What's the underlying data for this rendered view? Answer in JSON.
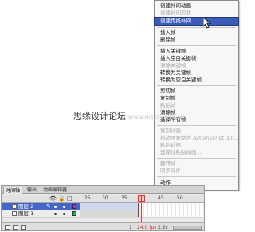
{
  "context_menu": {
    "items": [
      {
        "label": "创建补间动画",
        "enabled": true
      },
      {
        "label": "创建补间形状",
        "enabled": false
      },
      {
        "label": "创建传统补间",
        "enabled": true,
        "highlighted": true
      },
      {
        "label": "插入帧",
        "enabled": true
      },
      {
        "label": "删除帧",
        "enabled": true
      },
      {
        "label": "插入关键帧",
        "enabled": true
      },
      {
        "label": "插入空白关键帧",
        "enabled": true
      },
      {
        "label": "清除关键帧",
        "enabled": false
      },
      {
        "label": "转换为关键帧",
        "enabled": true
      },
      {
        "label": "转换为空白关键帧",
        "enabled": true
      },
      {
        "label": "剪切帧",
        "enabled": true
      },
      {
        "label": "复制帧",
        "enabled": true
      },
      {
        "label": "粘贴帧",
        "enabled": false
      },
      {
        "label": "清除帧",
        "enabled": true
      },
      {
        "label": "选择所有帧",
        "enabled": true
      },
      {
        "label": "复制动画",
        "enabled": false
      },
      {
        "label": "将动画复制为 ActionScript 3.0...",
        "enabled": false
      },
      {
        "label": "粘贴动画",
        "enabled": false
      },
      {
        "label": "选择性粘贴动画...",
        "enabled": false
      },
      {
        "label": "翻转帧",
        "enabled": false
      },
      {
        "label": "同步元件",
        "enabled": false
      },
      {
        "label": "动作",
        "enabled": true
      }
    ]
  },
  "watermark": {
    "text": "思缘设计论坛",
    "site": "WWW.MISSYUAN.COM"
  },
  "timeline": {
    "tabs": [
      "时间轴",
      "输出",
      "动画编辑器"
    ],
    "ruler_ticks": [
      "25",
      "30",
      "35",
      "40",
      "45",
      "50"
    ],
    "header_icons": {
      "eye": "👁",
      "lock": "🔒",
      "outline": "□"
    },
    "layers": [
      {
        "name": "图层 2",
        "selected": true,
        "color": "#9b30d0"
      },
      {
        "name": "图层 1",
        "selected": false,
        "color": "#22b24c"
      }
    ],
    "status": {
      "frame": "1",
      "fps": "24.0 fps",
      "time": "2.2s"
    }
  },
  "colors": {
    "highlight": "#3b5bb8",
    "playhead": "#ee3333"
  }
}
